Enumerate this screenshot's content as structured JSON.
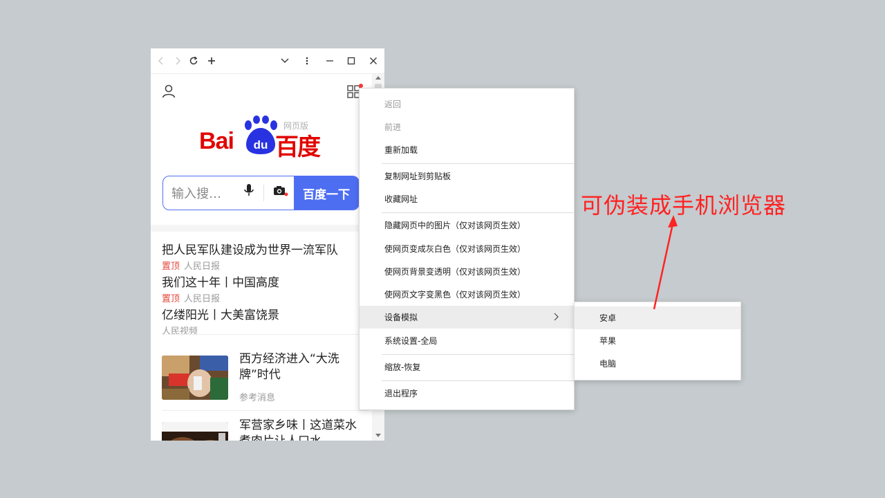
{
  "toolbar": {
    "back_icon": "chevron-left-icon",
    "forward_icon": "chevron-right-icon",
    "reload_icon": "reload-icon",
    "newtab_icon": "plus-icon",
    "dropdown_icon": "chevron-down-icon",
    "more_icon": "more-vertical-icon",
    "minimize_icon": "minimize-icon",
    "maximize_icon": "maximize-icon",
    "close_icon": "close-icon"
  },
  "page": {
    "logo_text_left": "Bai",
    "logo_text_paw": "du",
    "logo_text_right": "百度",
    "logo_badge": "网页版",
    "search_placeholder": "输入搜…",
    "search_button": "百度一下",
    "news": [
      {
        "title": "把人民军队建设成为世界一流军队",
        "tag": "置顶",
        "source": "人民日报"
      },
      {
        "title": "我们这十年丨中国高度",
        "tag": "置顶",
        "source": "人民日报"
      },
      {
        "title": "亿缕阳光丨大美富饶景",
        "tag": "",
        "source": "人民视频"
      }
    ],
    "cards": [
      {
        "title": "西方经济进入“大洗牌”时代",
        "source": "参考消息"
      },
      {
        "title": "军营家乡味丨这道菜水煮肉片让人口水",
        "source": ""
      }
    ]
  },
  "menu": {
    "items": [
      {
        "label": "返回",
        "disabled": true
      },
      {
        "label": "前进",
        "disabled": true
      },
      {
        "label": "重新加载"
      },
      {
        "label": "复制网址到剪贴板"
      },
      {
        "label": "收藏网址"
      },
      {
        "label": "隐藏网页中的图片（仅对该网页生效）"
      },
      {
        "label": "使网页变成灰白色（仅对该网页生效）"
      },
      {
        "label": "使网页背景变透明（仅对该网页生效）"
      },
      {
        "label": "使网页文字变黑色（仅对该网页生效）"
      },
      {
        "label": "设备模拟",
        "highlighted": true,
        "submenu": true
      },
      {
        "label": "系统设置-全局"
      },
      {
        "label": "缩放-恢复"
      },
      {
        "label": "退出程序"
      }
    ],
    "submenu": [
      {
        "label": "安卓",
        "highlighted": true
      },
      {
        "label": "苹果"
      },
      {
        "label": "电脑"
      }
    ]
  },
  "annotation": {
    "text": "可伪装成手机浏览器",
    "color": "#ff2222"
  },
  "colors": {
    "brand_blue": "#4e6ef2",
    "brand_red": "#e10601",
    "background": "#c5cbce"
  }
}
